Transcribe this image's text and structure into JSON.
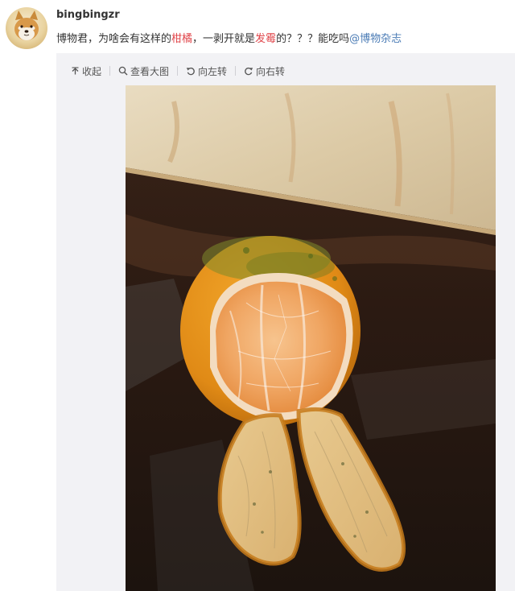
{
  "post": {
    "username": "bingbingzr",
    "text_parts": [
      "博物君，为啥会有这样的",
      "柑橘",
      "，一剥开就是",
      "发霉",
      "的？？？能吃吗",
      "@博物杂志"
    ]
  },
  "toolbar": {
    "collapse_label": "收起",
    "view_large_label": "查看大图",
    "rotate_left_label": "向左转",
    "rotate_right_label": "向右转"
  },
  "colors": {
    "highlight": "#e0454a",
    "mention": "#4a7bb5"
  },
  "icons": {
    "collapse": "arrow-up-icon",
    "view_large": "magnifier-icon",
    "rotate_left": "rotate-left-icon",
    "rotate_right": "rotate-right-icon"
  }
}
